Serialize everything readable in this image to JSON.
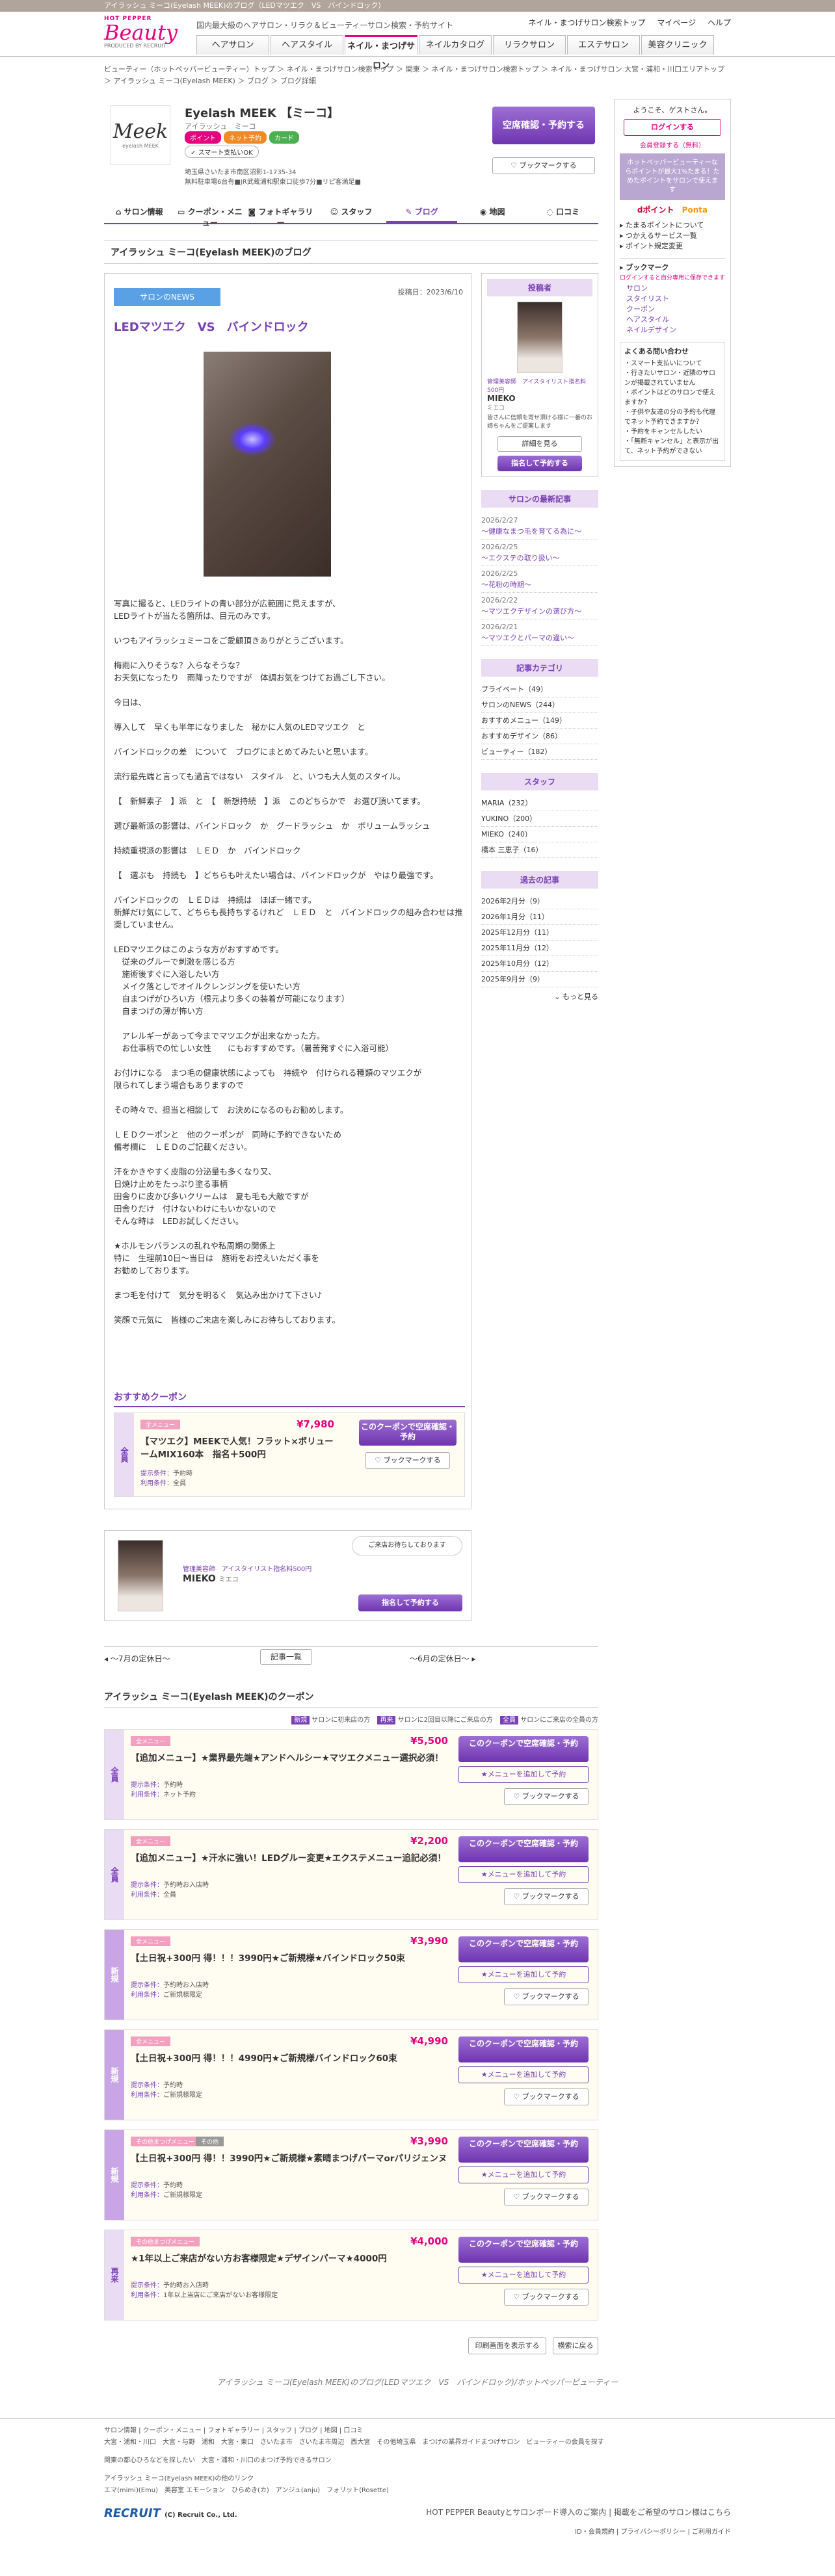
{
  "top_strip": "アイラッシュ ミーコ(Eyelash MEEK)のブログ（LEDマツエク　VS　バインドロック）",
  "header": {
    "logo_hp": "HOT PEPPER",
    "logo_beauty": "Beauty",
    "logo_by": "PRODUCED BY RECRUIT",
    "desc": "国内最大級のヘアサロン・リラク＆ビューティーサロン検索・予約サイト",
    "links": [
      "ネイル・まつげサロン検索トップ",
      "マイページ",
      "ヘルプ"
    ],
    "nav": [
      "ヘアサロン",
      "ヘアスタイル",
      "ネイル・まつげサロン",
      "ネイルカタログ",
      "リラクサロン",
      "エステサロン",
      "美容クリニック"
    ]
  },
  "breadcrumb": "ビューティー（ホットペッパービューティー）トップ ＞ ネイル・まつげサロン検索トップ ＞ 関東 ＞ ネイル・まつげサロン検索トップ ＞ ネイル・まつげサロン 大宮・浦和・川口エリアトップ ＞ アイラッシュ ミーコ(Eyelash MEEK) ＞ ブログ ＞ ブログ詳細",
  "salon": {
    "logo_text": "Meek",
    "logo_sub": "eyelash MEEK",
    "name": "Eyelash MEEK 【ミーコ】",
    "kana": "アイラッシュ　ミーコ",
    "tags": [
      "ポイント",
      "ネット予約",
      "カード"
    ],
    "smart_pay": "スマート支払いOK",
    "address": "埼玉県さいたま市南区沼影1-1735-34",
    "access": "無料駐車場6台有■JR武蔵浦和駅東口徒歩7分■リピ客満足■",
    "reserve_btn": "空席確認・予約する",
    "bookmark_btn": "ブックマークする"
  },
  "tabs": [
    "サロン情報",
    "クーポン・メニュー",
    "フォトギャラリー",
    "スタッフ",
    "ブログ",
    "地図",
    "口コミ"
  ],
  "sidebar": {
    "greeting": "ようこそ、ゲストさん。",
    "login": "ログインする",
    "register": "会員登録する（無料）",
    "promo": "ホットペッパービューティーならポイントが最大1%たまる！ためたポイントをサロンで使えます",
    "point_brands": [
      "dポイント",
      "Ponta"
    ],
    "links": [
      "たまるポイントについて",
      "つかえるサービス一覧",
      "ポイント規定変更"
    ],
    "blog_head": "ブックマーク",
    "blog_note": "ログインすると自分専用に保存できます",
    "blog_items": [
      "サロン",
      "スタイリスト",
      "クーポン",
      "ヘアスタイル",
      "ネイルデザイン"
    ],
    "faq_head": "よくある問い合わせ",
    "faq": [
      "スマート支払いについて",
      "行きたいサロン・近隣のサロンが掲載されていません",
      "ポイントはどのサロンで使えますか？",
      "子供や友達の分の予約も代理でネット予約できますか？",
      "予約をキャンセルしたい",
      "「無断キャンセル」と表示が出て、ネット予約ができない"
    ]
  },
  "blog_section_title": "アイラッシュ ミーコ(Eyelash MEEK)のブログ",
  "article": {
    "category_label": "サロンのNEWS",
    "date": "投稿日：2023/6/10",
    "title": "LEDマツエク　VS　バインドロック",
    "body": "写真に撮ると、LEDライトの青い部分が広範囲に見えますが、\nLEDライトが当たる箇所は、目元のみです。\n\nいつもアイラッシュミーコをご愛顧頂きありがとうございます。\n\n梅雨に入りそうな？入らなそうな？\nお天気になったり　雨降ったりですが　体調お気をつけてお過ごし下さい。\n\n今日は、\n\n導入して　早くも半年になりました　秘かに人気のLEDマツエク　と\n\nバインドロックの差　について　ブログにまとめてみたいと思います。\n\n流行最先端と言っても過言ではない　スタイル　と、いつも大人気のスタイル。\n\n【　新鮮素子　】派　と　【　新想持続　】派　このどちらかで　お選び頂いてます。\n\n選び最新派の影響は、バインドロック　か　グードラッシュ　か　ボリュームラッシュ\n\n持続重視派の影響は　ＬＥＤ　か　バインドロック\n\n【　選ぶも　持続も　】どちらも叶えたい場合は、バインドロックが　やはり最強です。\n\nバインドロックの　ＬＥＤは　持続は　ほぼ一緒です。\n新鮮だけ気にして、どちらも長持ちするけれど　ＬＥＤ　と　バインドロックの組み合わせは推奨していません。\n\nLEDマツエクはこのような方がおすすめです。\n　従来のグルーで刺激を感じる方\n　施術後すぐに入浴したい方\n　メイク落としでオイルクレンジングを使いたい方\n　自まつげがひろい方（根元より多くの装着が可能になります）\n　自まつげの薄が怖い方\n\n　アレルギーがあって今までマツエクが出来なかった方。\n　お仕事柄での忙しい女性　　にもおすすめです。（暑苦発すぐに入浴可能）\n\nお付けになる　まつ毛の健康状態によっても　持続や　付けられる種類のマツエクが\n限られてしまう場合もありますので\n\nその時々で、担当と相談して　お決めになるのもお勧めします。\n\nＬＥＤクーポンと　他のクーポンが　同時に予約できないため\n備考欄に　ＬＥＤのご記載ください。\n\n汗をかきやすく皮脂の分泌量も多くなり又、\n日焼け止めをたっぷり塗る事柄\n田舎りに皮かび多いクリームは　夏も毛も大敵ですが\n田舎りだけ　付けないわけにもいかないので\nそんな時は　LEDお試しください。\n\n★ホルモンバランスの乱れや私周期の関係上\n特に　生理前10日～当日は　施術をお控えいただく事を\nお勧めしております。\n\nまつ毛を付けて　気分を明るく　気込み出かけて下さい♪\n\n笑顔で元気に　皆様のご来店を楽しみにお待ちしております。"
  },
  "article_coupon": {
    "head": "おすすめクーポン",
    "side": "全員",
    "badge": "全メニュー",
    "price": "¥7,980",
    "title": "【マツエク】MEEKで人気！フラット×ボリューームMIX160本　指名＋500円",
    "cond_label1": "提示条件：",
    "cond1": "予約時",
    "cond_label2": "利用条件：",
    "cond2": "全員",
    "btn": "このクーポンで空席確認・予約",
    "bookmark": "ブックマークする"
  },
  "staff": {
    "posted_by": "投稿者",
    "title": "管理美容師　アイスタイリスト指名料500円",
    "name": "MIEKO",
    "kana": "ミエコ",
    "desc": "皆さんに信頼を寄せ頂ける様に一番のお姉ちゃんをご提案します",
    "detail_btn": "詳細を見る",
    "reserve_btn": "指名して予約する",
    "bubble": "ご来店お待ちしております"
  },
  "recent": {
    "head": "サロンの最新記事",
    "items": [
      {
        "date": "2026/2/27",
        "title": "～健康なまつ毛を育てる為に～"
      },
      {
        "date": "2026/2/25",
        "title": "～エクステの取り扱い～"
      },
      {
        "date": "2026/2/25",
        "title": "～花粉の時期～"
      },
      {
        "date": "2026/2/22",
        "title": "～マツエクデザインの選び方～"
      },
      {
        "date": "2026/2/21",
        "title": "～マツエクとパーマの違い～"
      }
    ]
  },
  "categories": {
    "head": "記事カテゴリ",
    "items": [
      "プライベート（49）",
      "サロンのNEWS（244）",
      "おすすめメニュー（149）",
      "おすすめデザイン（86）",
      "ビューティー（182）"
    ]
  },
  "staff_list": {
    "head": "スタッフ",
    "items": [
      "MARIA（232）",
      "YUKINO（200）",
      "MIEKO（240）",
      "橋本 三恵子（16）"
    ]
  },
  "archive": {
    "head": "過去の記事",
    "items": [
      "2026年2月分（9）",
      "2026年1月分（11）",
      "2025年12月分（11）",
      "2025年11月分（12）",
      "2025年10月分（12）",
      "2025年9月分（9）"
    ],
    "more": "もっと見る"
  },
  "pager": {
    "prev": "～7月の定休日～",
    "list": "記事一覧",
    "next": "～6月の定休日～"
  },
  "coupon_list": {
    "head": "アイラッシュ ミーコ(Eyelash MEEK)のクーポン",
    "legend": [
      {
        "k": "新規",
        "v": "サロンに初来店の方"
      },
      {
        "k": "再来",
        "v": "サロンに2回目以降にご来店の方"
      },
      {
        "k": "全員",
        "v": "サロンにご来店の全員の方"
      }
    ],
    "items": [
      {
        "side": "全員",
        "badge": "全メニュー",
        "badge2": "",
        "price": "¥5,500",
        "title": "【追加メニュー】★業界最先端★アンドヘルシー★マツエクメニュー選択必須！",
        "cond1": "予約時",
        "cond2": "ネット予約",
        "btn": "このクーポンで空席確認・予約",
        "btn2": "★メニューを追加して予約",
        "bm": "ブックマークする"
      },
      {
        "side": "全員",
        "badge": "全メニュー",
        "badge2": "",
        "price": "¥2,200",
        "title": "【追加メニュー】★汗水に強い！LEDグルー変更★エクステメニュー追記必須！",
        "cond1": "予約時お入店時",
        "cond2": "全員",
        "btn": "このクーポンで空席確認・予約",
        "btn2": "★メニューを追加して予約",
        "bm": "ブックマークする"
      },
      {
        "side": "新規",
        "badge": "全メニュー",
        "badge2": "",
        "price": "¥3,990",
        "title": "【土日祝+300円 得！！！3990円★ご新規様★バインドロック50束",
        "cond1": "予約時お入店時",
        "cond2": "ご新規様限定",
        "btn": "このクーポンで空席確認・予約",
        "btn2": "★メニューを追加して予約",
        "bm": "ブックマークする"
      },
      {
        "side": "新規",
        "badge": "全メニュー",
        "badge2": "",
        "price": "¥4,990",
        "title": "【土日祝+300円 得！！！4990円★ご新規様バインドロック60束",
        "cond1": "予約時",
        "cond2": "ご新規様限定",
        "btn": "このクーポンで空席確認・予約",
        "btn2": "★メニューを追加して予約",
        "bm": "ブックマークする"
      },
      {
        "side": "新規",
        "badge": "その他まつげメニュー",
        "badge2": "その他",
        "price": "¥3,990",
        "title": "【土日祝+300円 得！！3990円★ご新規様★素晴まつげパーマorパリジェンヌ",
        "cond1": "予約時",
        "cond2": "ご新規様限定",
        "btn": "このクーポンで空席確認・予約",
        "btn2": "★メニューを追加して予約",
        "bm": "ブックマークする"
      },
      {
        "side": "再来",
        "badge": "その他まつげメニュー",
        "badge2": "",
        "price": "¥4,000",
        "title": "★1年以上ご来店がない方お客様限定★デザインパーマ★4000円",
        "cond1": "予約時お入店時",
        "cond2": "1年以上当店にご来店がないお客様限定",
        "btn": "このクーポンで空席確認・予約",
        "btn2": "★メニューを追加して予約",
        "bm": "ブックマークする"
      }
    ],
    "cond_label1": "提示条件：",
    "cond_label2": "利用条件："
  },
  "footer_btns": {
    "print": "印刷画面を表示する",
    "top": "横索に戻る"
  },
  "footnote": "アイラッシュ ミーコ(Eyelash MEEK)のブログ(LEDマツエク　VS　バインドロック)/ホットペッパービューティー",
  "footer": {
    "links": [
      "サロン情報",
      "クーポン・メニュー",
      "フォトギャラリー",
      "スタッフ",
      "ブログ",
      "地図",
      "口コミ"
    ],
    "line2": "大宮・浦和・川口　大宮・与野　浦和　大宮・東口　さいたま市　さいたま市周辺　西大宮　その他埼玉県　まつげの業界ガイドまつげサロン　ビューティーの会員を探す",
    "line3": "関東の都心ひろなどを探したい　大宮・浦和・川口のまつげ予約できるサロン",
    "line4a": "アイラッシュ ミーコ(Eyelash MEEK)の他のリンク",
    "line4b": "エマ(mimi)(Emu)　美容室 エモーション　ひらめき(カ)　アンジュ(anju)　フォリット(Rosette)",
    "recruit": "RECRUIT",
    "copyright": "(C) Recruit Co., Ltd.",
    "right_links": [
      "HOT PEPPER Beautyとサロンボード導入のご案内",
      "掲載をご希望のサロン様はこちら"
    ],
    "bottom_links": [
      "ID・会員規約",
      "プライバシーポリシー",
      "ご利用ガイド"
    ]
  }
}
